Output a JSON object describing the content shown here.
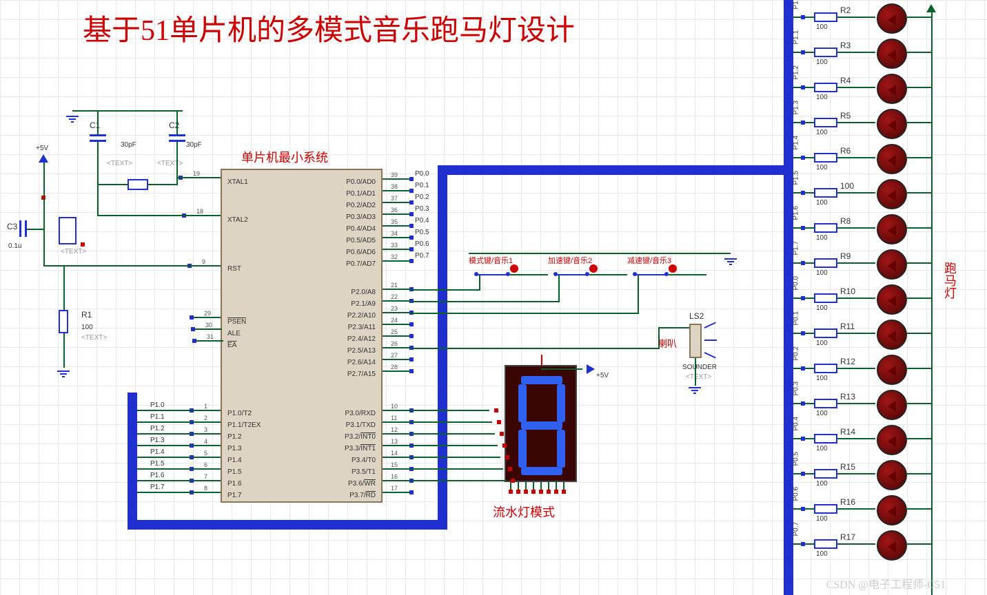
{
  "title": "基于51单片机的多模式音乐跑马灯设计",
  "ic": {
    "label": "单片机最小系统",
    "left_pins": [
      {
        "num": "19",
        "name": "XTAL1"
      },
      {
        "num": "18",
        "name": "XTAL2"
      },
      {
        "num": "9",
        "name": "RST"
      },
      {
        "num": "29",
        "name": "PSEN",
        "ol": true
      },
      {
        "num": "30",
        "name": "ALE"
      },
      {
        "num": "31",
        "name": "EA",
        "ol": true
      },
      {
        "num": "1",
        "name": "P1.0/T2"
      },
      {
        "num": "2",
        "name": "P1.1/T2EX"
      },
      {
        "num": "3",
        "name": "P1.2"
      },
      {
        "num": "4",
        "name": "P1.3"
      },
      {
        "num": "5",
        "name": "P1.4"
      },
      {
        "num": "6",
        "name": "P1.5"
      },
      {
        "num": "7",
        "name": "P1.6"
      },
      {
        "num": "8",
        "name": "P1.7"
      }
    ],
    "right_pins": [
      {
        "num": "39",
        "name": "P0.0/AD0"
      },
      {
        "num": "38",
        "name": "P0.1/AD1"
      },
      {
        "num": "37",
        "name": "P0.2/AD2"
      },
      {
        "num": "36",
        "name": "P0.3/AD3"
      },
      {
        "num": "35",
        "name": "P0.4/AD4"
      },
      {
        "num": "34",
        "name": "P0.5/AD5"
      },
      {
        "num": "33",
        "name": "P0.6/AD6"
      },
      {
        "num": "32",
        "name": "P0.7/AD7"
      },
      {
        "num": "21",
        "name": "P2.0/A8"
      },
      {
        "num": "22",
        "name": "P2.1/A9"
      },
      {
        "num": "23",
        "name": "P2.2/A10"
      },
      {
        "num": "24",
        "name": "P2.3/A11"
      },
      {
        "num": "25",
        "name": "P2.4/A12"
      },
      {
        "num": "26",
        "name": "P2.5/A13"
      },
      {
        "num": "27",
        "name": "P2.6/A14"
      },
      {
        "num": "28",
        "name": "P2.7/A15"
      },
      {
        "num": "10",
        "name": "P3.0/RXD"
      },
      {
        "num": "11",
        "name": "P3.1/TXD"
      },
      {
        "num": "12",
        "name": "P3.2/INT0",
        "ol": "INT0"
      },
      {
        "num": "13",
        "name": "P3.3/INT1",
        "ol": "INT1"
      },
      {
        "num": "14",
        "name": "P3.4/T0"
      },
      {
        "num": "15",
        "name": "P3.5/T1"
      },
      {
        "num": "16",
        "name": "P3.6/WR",
        "ol": "WR"
      },
      {
        "num": "17",
        "name": "P3.7/RD",
        "ol": "RD"
      }
    ]
  },
  "caps": [
    {
      "ref": "C1",
      "val": "30pF"
    },
    {
      "ref": "C2",
      "val": "30pF"
    },
    {
      "ref": "C3",
      "val": "0.1u"
    }
  ],
  "text_placeholder": "<TEXT>",
  "r1": {
    "ref": "R1",
    "val": "100"
  },
  "power": "+5V",
  "buttons": [
    {
      "label": "模式键/音乐1"
    },
    {
      "label": "加速键/音乐2"
    },
    {
      "label": "减速键/音乐3"
    }
  ],
  "sounder": {
    "ref": "LS2",
    "label": "喇叭",
    "type": "SOUNDER"
  },
  "seg7": {
    "label": "流水灯模式"
  },
  "side_label": "跑马灯",
  "resistors": [
    {
      "ref": "R2",
      "val": "100",
      "net": "P1.0"
    },
    {
      "ref": "R3",
      "val": "100",
      "net": "P1.1"
    },
    {
      "ref": "R4",
      "val": "100",
      "net": "P1.2"
    },
    {
      "ref": "R5",
      "val": "100",
      "net": "P1.3"
    },
    {
      "ref": "R6",
      "val": "100",
      "net": "P1.4"
    },
    {
      "ref": "100",
      "val": "100",
      "net": "P1.5"
    },
    {
      "ref": "R8",
      "val": "100",
      "net": "P1.6"
    },
    {
      "ref": "R9",
      "val": "100",
      "net": "P1.7"
    },
    {
      "ref": "R10",
      "val": "100",
      "net": "P0.0"
    },
    {
      "ref": "R11",
      "val": "100",
      "net": "P0.1"
    },
    {
      "ref": "R12",
      "val": "100",
      "net": "P0.2"
    },
    {
      "ref": "R13",
      "val": "100",
      "net": "P0.3"
    },
    {
      "ref": "R14",
      "val": "100",
      "net": "P0.4"
    },
    {
      "ref": "R15",
      "val": "100",
      "net": "P0.5"
    },
    {
      "ref": "R16",
      "val": "100",
      "net": "P0.6"
    },
    {
      "ref": "R17",
      "val": "100",
      "net": "P0.7"
    }
  ],
  "nets_p1": [
    "P1.0",
    "P1.1",
    "P1.2",
    "P1.3",
    "P1.4",
    "P1.5",
    "P1.6",
    "P1.7"
  ],
  "nets_p0": [
    "P0.0",
    "P0.1",
    "P0.2",
    "P0.3",
    "P0.4",
    "P0.5",
    "P0.6",
    "P0.7"
  ],
  "watermark": "CSDN @电子工程师-C51"
}
